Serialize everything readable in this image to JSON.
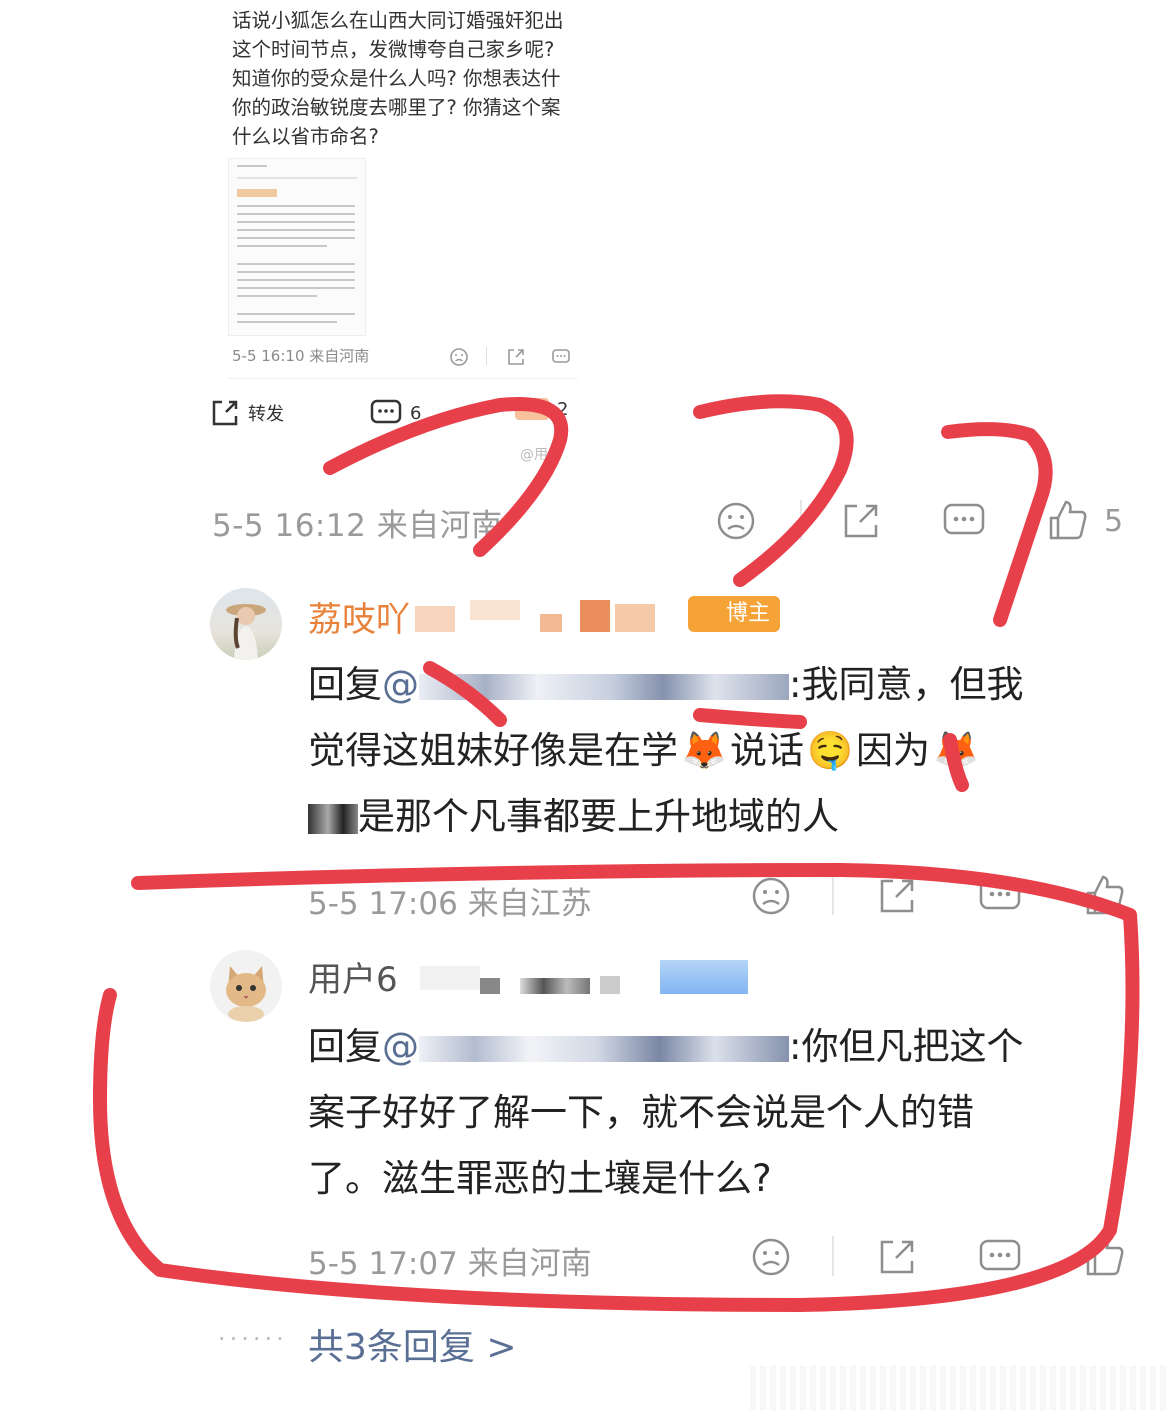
{
  "quoted_post": {
    "text": "话说小狐怎么在山西大同订婚强奸犯出\n这个时间节点，发微博夸自己家乡呢?\n知道你的受众是什么人吗? 你想表达什\n你的政治敏锐度去哪里了? 你猜这个案\n什么以省市命名?",
    "meta": "5-5 16:10 来自河南"
  },
  "post_actions": {
    "repost_label": "转发",
    "comment_count": "6",
    "like_count": "2"
  },
  "watermark": "@用户",
  "post_meta": {
    "time": "5-5 16:12",
    "location": "来自河南",
    "like_count": "5"
  },
  "comments": [
    {
      "name": "荔吱吖",
      "badge": "博主",
      "reply_prefix": "回复",
      "mention": "@",
      "line1": ":我同意，但我",
      "line2a": "觉得这姐妹好像是在学",
      "line2b": "说话",
      "line2c": "因为",
      "line3": "是那个凡事都要上升地域的人",
      "time": "5-5 17:06",
      "location": "来自江苏"
    },
    {
      "name": "用户6",
      "reply_prefix": "回复",
      "mention": "@",
      "line1": ":你但凡把这个",
      "line2": "案子好好了解一下，就不会说是个人的错",
      "line3": "了。滋生罪恶的土壤是什么?",
      "time": "5-5 17:07",
      "location": "来自河南"
    }
  ],
  "more_replies": "共3条回复 >",
  "colors": {
    "annotation_red": "#e8404a",
    "mention_blue": "#5a6f94",
    "name_orange": "#e8823a",
    "badge_orange": "#f5a236",
    "meta_gray": "#9a9a9a"
  }
}
